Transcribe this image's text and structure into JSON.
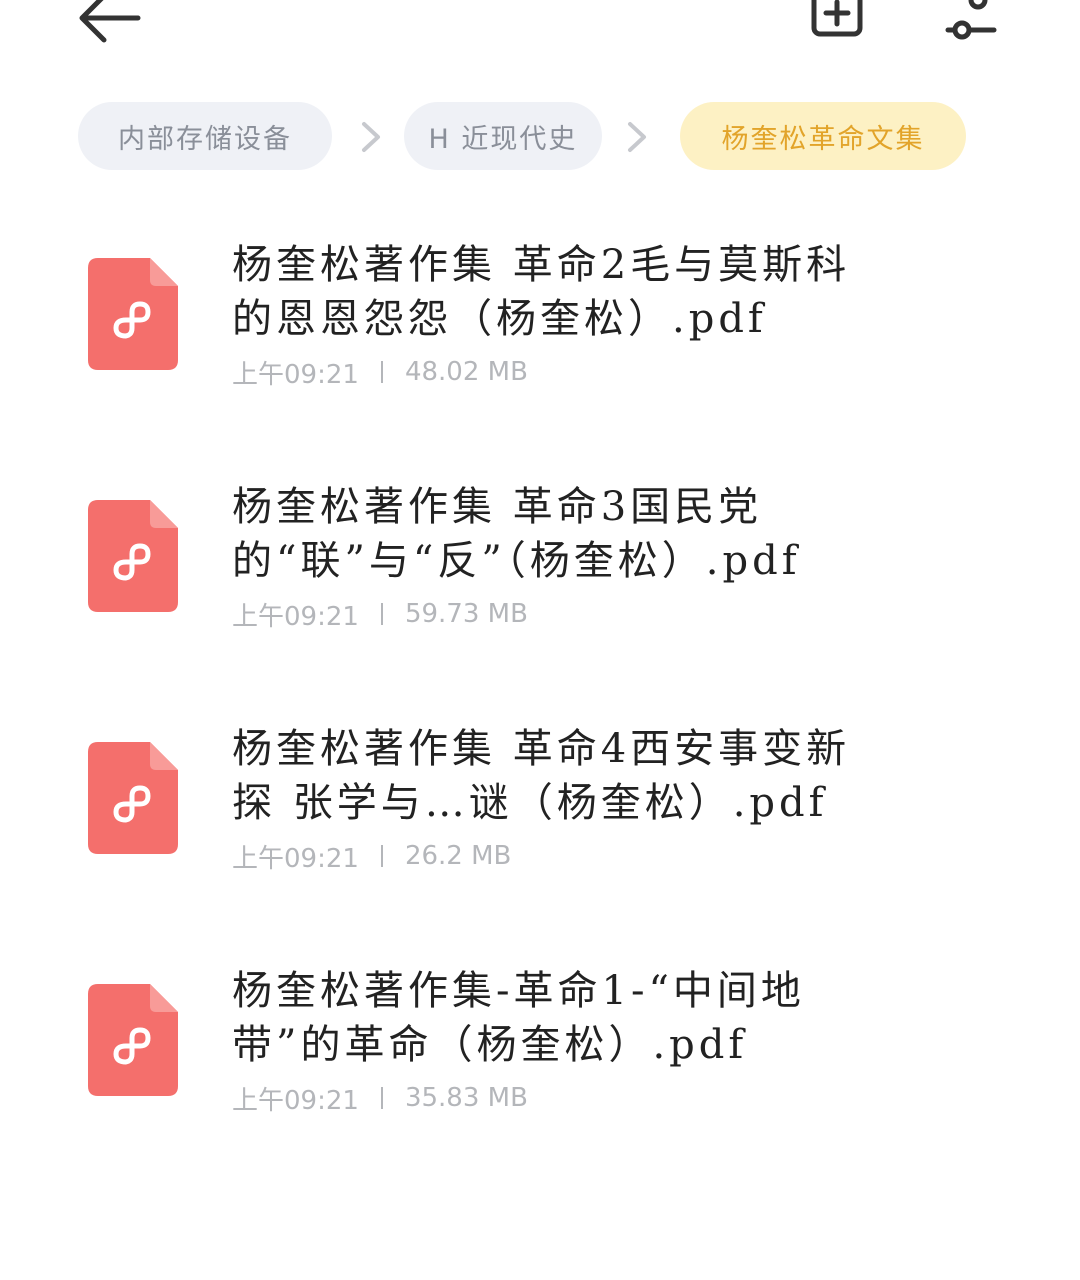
{
  "toolbar": {
    "back_icon": "arrow-left-icon",
    "add_icon": "add-box-icon",
    "filter_icon": "sliders-icon"
  },
  "breadcrumbs": [
    {
      "label": "内部存储设备"
    },
    {
      "label": "H 近现代史"
    },
    {
      "label": "杨奎松革命文集"
    }
  ],
  "colors": {
    "pdf_icon": "#f46f6c",
    "crumb_bg": "#eff1f6",
    "crumb_active_bg": "#fdf1c4",
    "crumb_active_text": "#e2a42a"
  },
  "files": [
    {
      "name": "杨奎松著作集 革命2毛与莫斯科的恩恩怨怨（杨奎松）.pdf",
      "time": "上午09:21",
      "size": "48.02 MB"
    },
    {
      "name": "杨奎松著作集 革命3国民党的“联”与“反”（杨奎松）.pdf",
      "time": "上午09:21",
      "size": "59.73 MB"
    },
    {
      "name": "杨奎松著作集 革命4西安事变新探 张学与…谜（杨奎松）.pdf",
      "time": "上午09:21",
      "size": "26.2 MB"
    },
    {
      "name": "杨奎松著作集-革命1-“中间地带”的革命（杨奎松）.pdf",
      "time": "上午09:21",
      "size": "35.83 MB"
    }
  ]
}
